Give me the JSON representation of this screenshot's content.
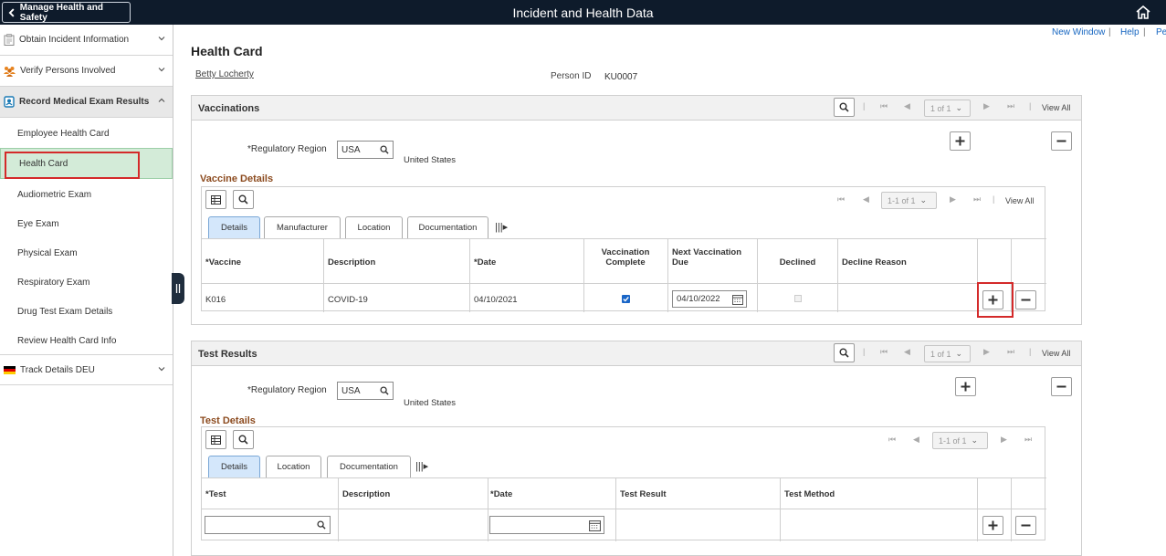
{
  "topbar": {
    "back_label": "Manage Health and Safety",
    "title": "Incident and Health Data"
  },
  "sidebar": {
    "sections": [
      {
        "label": "Obtain Incident Information"
      },
      {
        "label": "Verify Persons Involved"
      },
      {
        "label": "Record Medical Exam Results"
      },
      {
        "label": "Track Details DEU"
      }
    ],
    "items": [
      {
        "label": "Employee Health Card"
      },
      {
        "label": "Health Card"
      },
      {
        "label": "Audiometric Exam"
      },
      {
        "label": "Eye Exam"
      },
      {
        "label": "Physical Exam"
      },
      {
        "label": "Respiratory Exam"
      },
      {
        "label": "Drug Test Exam Details"
      },
      {
        "label": "Review Health Card Info"
      }
    ]
  },
  "links": {
    "new_window": "New Window",
    "sep1": "|",
    "help": "Help",
    "sep2": "|",
    "pe": "Pe"
  },
  "page": {
    "title": "Health Card",
    "person_name": "Betty Locherty",
    "person_id_label": "Person ID",
    "person_id": "KU0007"
  },
  "vaccinations": {
    "title": "Vaccinations",
    "pager": "1 of 1",
    "view_all": "View All",
    "region_label": "*Regulatory Region",
    "region_value": "USA",
    "region_desc": "United States",
    "details_title": "Vaccine Details",
    "grid_pager": "1-1 of 1",
    "grid_view_all": "View All",
    "tabs": [
      "Details",
      "Manufacturer",
      "Location",
      "Documentation"
    ],
    "headers": [
      "*Vaccine",
      "Description",
      "*Date",
      "Vaccination Complete",
      "Next Vaccination Due",
      "Declined",
      "Decline Reason"
    ],
    "row": {
      "vaccine": "K016",
      "description": "COVID-19",
      "date": "04/10/2021",
      "complete": true,
      "next_due": "04/10/2022",
      "declined": false,
      "decline_reason": ""
    }
  },
  "test_results": {
    "title": "Test Results",
    "pager": "1 of 1",
    "view_all": "View All",
    "region_label": "*Regulatory Region",
    "region_value": "USA",
    "region_desc": "United States",
    "details_title": "Test Details",
    "grid_pager": "1-1 of 1",
    "tabs": [
      "Details",
      "Location",
      "Documentation"
    ],
    "headers": [
      "*Test",
      "Description",
      "*Date",
      "Test Result",
      "Test Method"
    ],
    "row": {
      "test": "",
      "description": "",
      "date": "",
      "result": "",
      "method": ""
    }
  },
  "colors": {
    "topbar": "#0e1b2b",
    "active_item": "#d3ebd8",
    "highlight": "#d42a2a",
    "link": "#1565c0",
    "subtitle": "#8c4b1f"
  },
  "icons": [
    "home-icon",
    "chevron-left-icon",
    "chevron-down-icon",
    "chevron-up-icon",
    "clipboard-icon",
    "people-icon",
    "medical-icon",
    "flag-icon",
    "search-icon",
    "plus-icon",
    "minus-icon",
    "calendar-icon",
    "grid-icon",
    "first-icon",
    "prev-icon",
    "next-icon",
    "last-icon"
  ]
}
